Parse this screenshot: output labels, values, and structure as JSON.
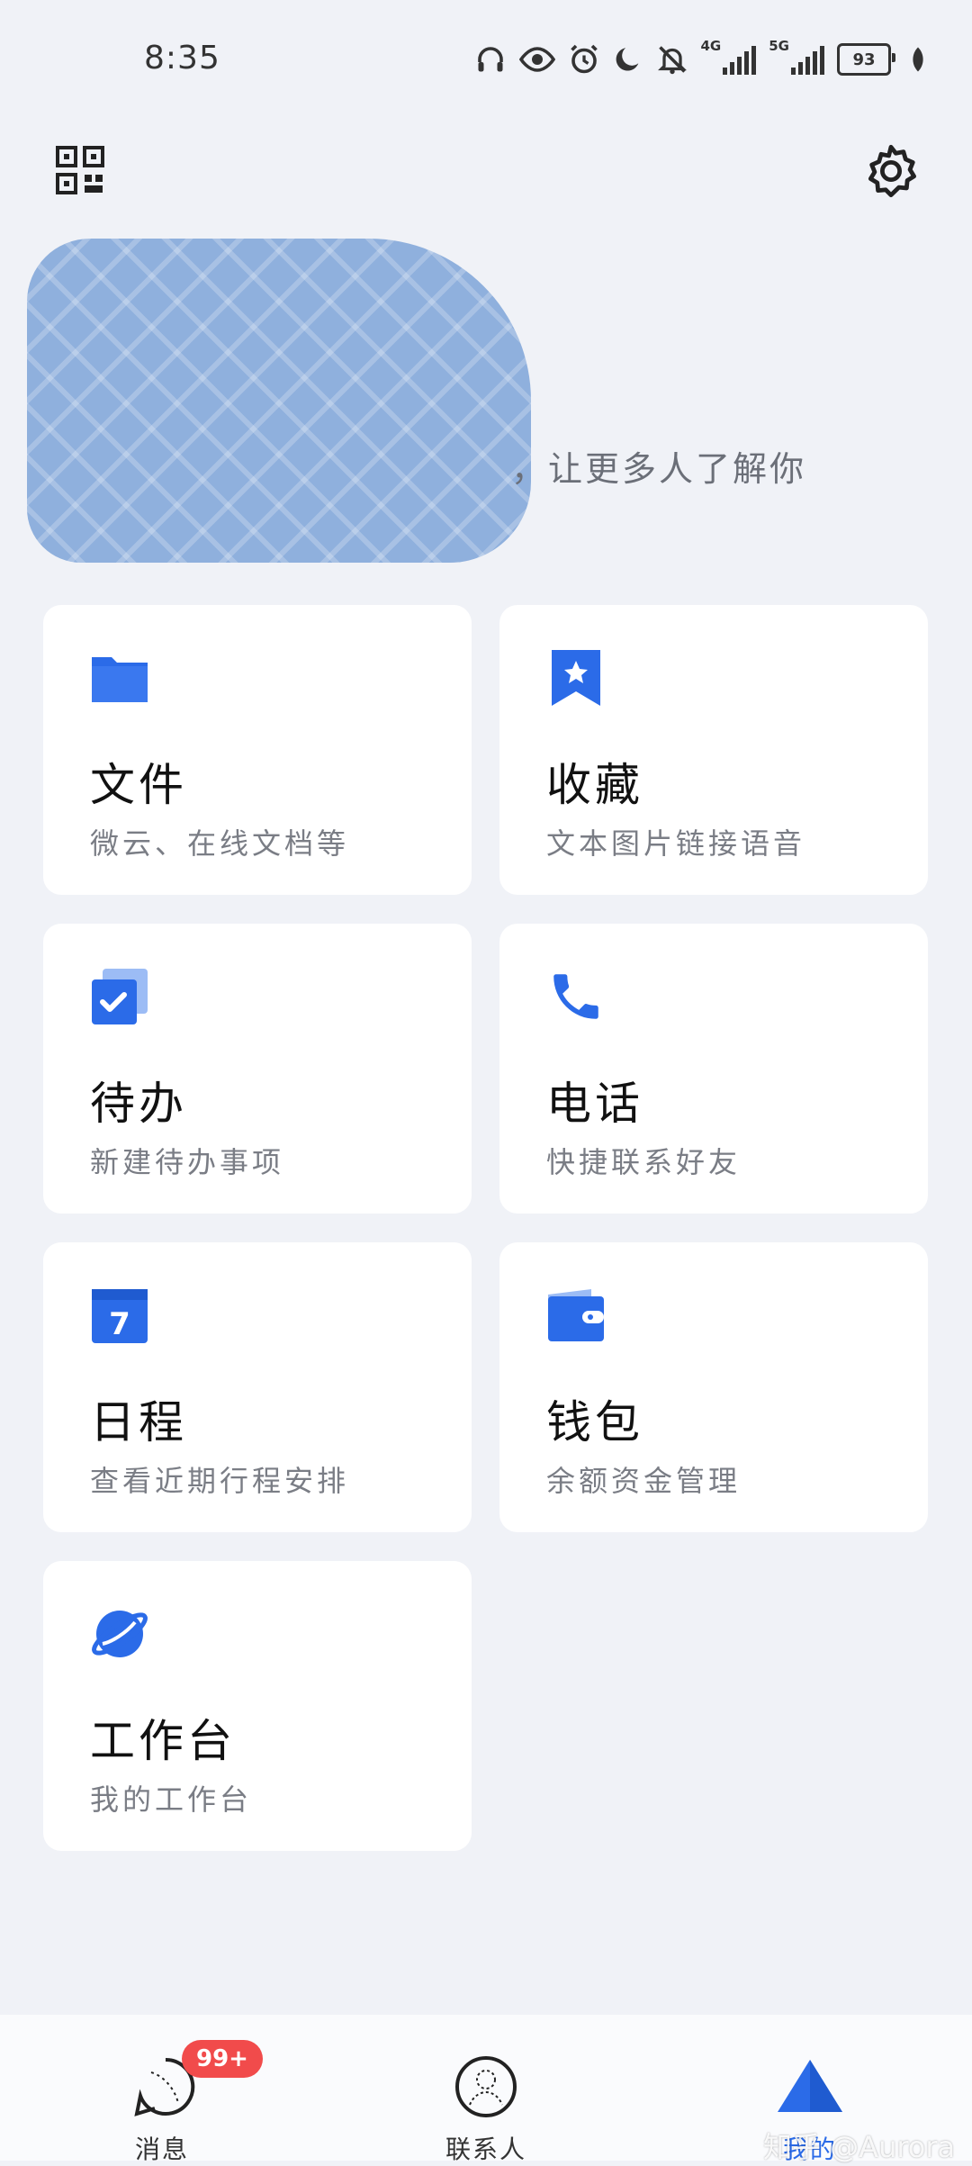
{
  "status_bar": {
    "time": "8:35",
    "net1": "4G",
    "net2": "5G",
    "battery": "93",
    "icons": [
      "headphones-icon",
      "eye-icon",
      "alarm-icon",
      "moon-icon",
      "bell-off-icon",
      "signal-4g-icon",
      "signal-5g-icon",
      "battery-icon",
      "leaf-icon"
    ]
  },
  "header": {
    "qr_icon": "qr-code-icon",
    "settings_icon": "gear-icon"
  },
  "profile": {
    "tagline": "，让更多人了解你"
  },
  "accent_color": "#2b6be8",
  "cards": [
    {
      "title": "文件",
      "subtitle": "微云、在线文档等",
      "icon": "folder-icon"
    },
    {
      "title": "收藏",
      "subtitle": "文本图片链接语音",
      "icon": "bookmark-star-icon"
    },
    {
      "title": "待办",
      "subtitle": "新建待办事项",
      "icon": "checkbox-icon"
    },
    {
      "title": "电话",
      "subtitle": "快捷联系好友",
      "icon": "phone-icon"
    },
    {
      "title": "日程",
      "subtitle": "查看近期行程安排",
      "icon": "calendar-icon",
      "calendar_day": "7"
    },
    {
      "title": "钱包",
      "subtitle": "余额资金管理",
      "icon": "wallet-icon"
    },
    {
      "title": "工作台",
      "subtitle": "我的工作台",
      "icon": "planet-icon"
    }
  ],
  "bottom_nav": {
    "tabs": [
      {
        "label": "消息",
        "badge": "99+",
        "icon": "message-icon"
      },
      {
        "label": "联系人",
        "icon": "contacts-icon"
      },
      {
        "label": "我的",
        "icon": "mine-triangle-icon"
      }
    ]
  },
  "watermark": "知乎 @Aurora"
}
